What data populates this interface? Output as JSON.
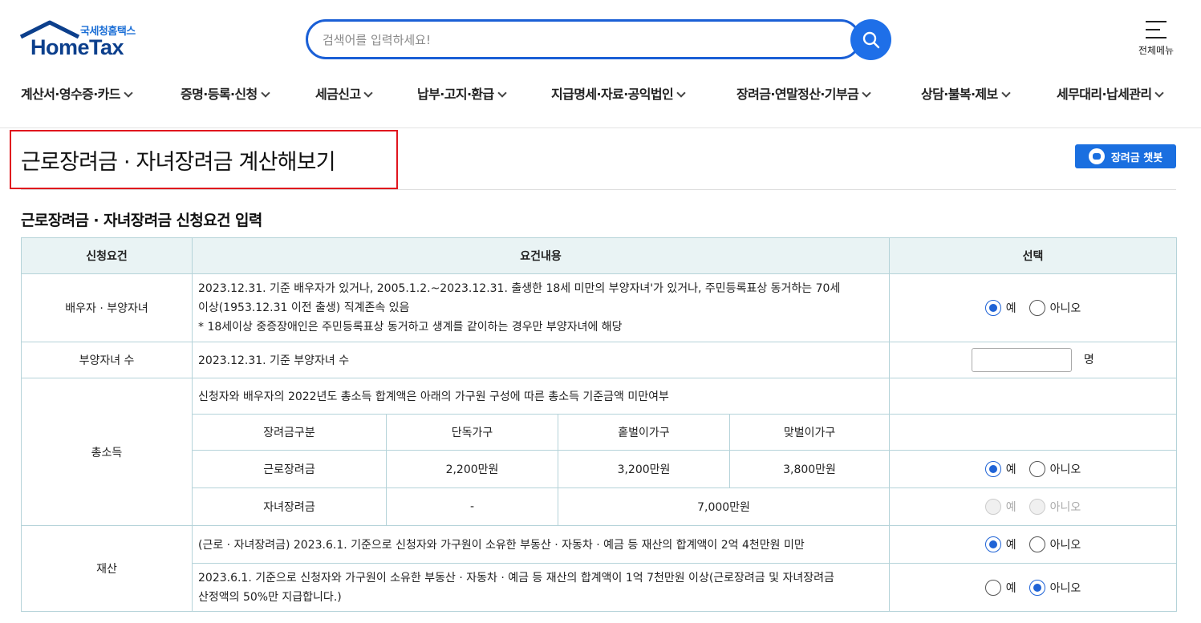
{
  "header": {
    "logo_sub": "국세청홈택스",
    "logo_main": "HomeTax",
    "search_placeholder": "검색어를 입력하세요!",
    "all_menu_label": "전체메뉴",
    "nav": [
      {
        "label": "계산서·영수증·카드"
      },
      {
        "label": "증명·등록·신청"
      },
      {
        "label": "세금신고"
      },
      {
        "label": "납부·고지·환급"
      },
      {
        "label": "지급명세·자료·공익법인"
      },
      {
        "label": "장려금·연말정산·기부금"
      },
      {
        "label": "상담·불복·제보"
      },
      {
        "label": "세무대리·납세관리"
      }
    ]
  },
  "page": {
    "title": "근로장려금 · 자녀장려금 계산해보기",
    "chatbot_label": "장려금 챗봇",
    "section_title": "근로장려금 · 자녀장려금 신청요건 입력"
  },
  "table": {
    "headers": [
      "신청요건",
      "요건내용",
      "선택"
    ],
    "yes": "예",
    "no": "아니오",
    "unit_people": "명",
    "spouse": {
      "label": "배우자 · 부양자녀",
      "line1": "2023.12.31. 기준 배우자가 있거나, 2005.1.2.~2023.12.31. 출생한 18세 미만의 부양자녀'가 있거나, 주민등록표상 동거하는 70세",
      "line2": "이상(1953.12.31 이전 출생) 직계존속 있음",
      "line3": "* 18세이상 중증장애인은 주민등록표상 동거하고 생계를 같이하는 경우만 부양자녀에 해당"
    },
    "children": {
      "label": "부양자녀 수",
      "content": "2023.12.31. 기준 부양자녀 수"
    },
    "income": {
      "label": "총소득",
      "desc": "신청자와 배우자의 2022년도 총소득 합계액은 아래의 가구원 구성에 따른 총소득 기준금액 미만여부",
      "sub_headers": [
        "장려금구분",
        "단독가구",
        "홑벌이가구",
        "맞벌이가구"
      ],
      "work_row": [
        "근로장려금",
        "2,200만원",
        "3,200만원",
        "3,800만원"
      ],
      "child_row": [
        "자녀장려금",
        "-",
        "7,000만원"
      ]
    },
    "property": {
      "label": "재산",
      "row1": "(근로 · 자녀장려금) 2023.6.1. 기준으로 신청자와 가구원이 소유한 부동산 · 자동차 · 예금 등 재산의 합계액이 2억 4천만원 미만",
      "row2_line1": "2023.6.1. 기준으로 신청자와 가구원이 소유한 부동산 · 자동차 · 예금 등 재산의 합계액이 1억 7천만원 이상(근로장려금 및 자녀장려금",
      "row2_line2": "산정액의 50%만 지급합니다.)"
    }
  }
}
